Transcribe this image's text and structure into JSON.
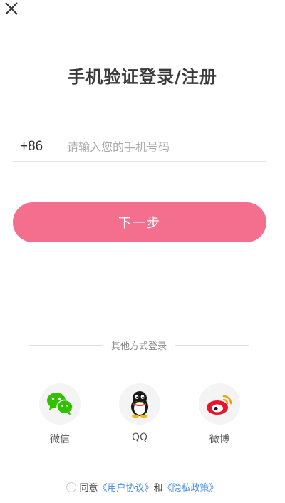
{
  "header": {
    "close_icon": "close-icon"
  },
  "login": {
    "title": "手机验证登录/注册",
    "country_code": "+86",
    "phone_placeholder": "请输入您的手机号码",
    "phone_value": "",
    "next_label": "下一步"
  },
  "other_login": {
    "title": "其他方式登录",
    "options": [
      {
        "label": "微信",
        "icon": "wechat-icon"
      },
      {
        "label": "QQ",
        "icon": "qq-icon"
      },
      {
        "label": "微博",
        "icon": "weibo-icon"
      }
    ]
  },
  "agreement": {
    "agree": "同意",
    "user_agreement": "《用户协议》",
    "and": "和",
    "privacy_policy": "《隐私政策》"
  },
  "colors": {
    "accent": "#f46f8e",
    "link": "#4a8fe8",
    "wechat": "#2dc100",
    "weibo": "#e6162d"
  }
}
